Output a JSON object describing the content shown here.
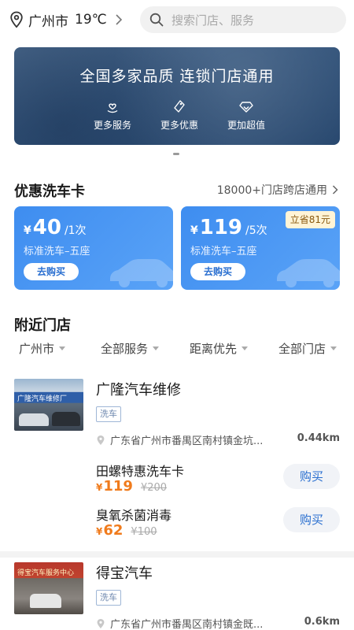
{
  "topbar": {
    "city": "广州市",
    "temperature": "19℃",
    "search_placeholder": "搜索门店、服务"
  },
  "banner": {
    "title": "全国多家品质  连锁门店通用",
    "features": [
      {
        "label": "更多服务",
        "icon": "heart-hand-icon"
      },
      {
        "label": "更多优惠",
        "icon": "tag-icon"
      },
      {
        "label": "更加超值",
        "icon": "diamond-icon"
      }
    ]
  },
  "wash_cards": {
    "title": "优惠洗车卡",
    "link": "18000+门店跨店通用",
    "cards": [
      {
        "yen": "¥",
        "amount": "40",
        "unit": "/1次",
        "desc": "标准洗车–五座",
        "button": "去购买",
        "badge": ""
      },
      {
        "yen": "¥",
        "amount": "119",
        "unit": "/5次",
        "desc": "标准洗车–五座",
        "button": "去购买",
        "badge": "立省81元"
      }
    ]
  },
  "nearby": {
    "title": "附近门店",
    "filters": [
      "广州市",
      "全部服务",
      "距离优先",
      "全部门店"
    ]
  },
  "stores": [
    {
      "name": "广隆汽车维修",
      "tag": "洗车",
      "address": "广东省广州市番禺区南村镇金坑...",
      "distance": "0.44km",
      "image_sign": "广隆汽车维修厂",
      "services": [
        {
          "name": "田螺特惠洗车卡",
          "yen": "¥",
          "price": "119",
          "original": "¥200",
          "button": "购买"
        },
        {
          "name": "臭氧杀菌消毒",
          "yen": "¥",
          "price": "62",
          "original": "¥100",
          "button": "购买"
        }
      ]
    },
    {
      "name": "得宝汽车",
      "tag": "洗车",
      "address": "广东省广州市番禺区南村镇金既...",
      "distance": "0.6km",
      "image_sign": "得宝汽车服务中心"
    }
  ],
  "colors": {
    "accent_blue": "#3e8df0",
    "price_orange": "#f07b1c",
    "banner_dark": "#2a4a70"
  }
}
